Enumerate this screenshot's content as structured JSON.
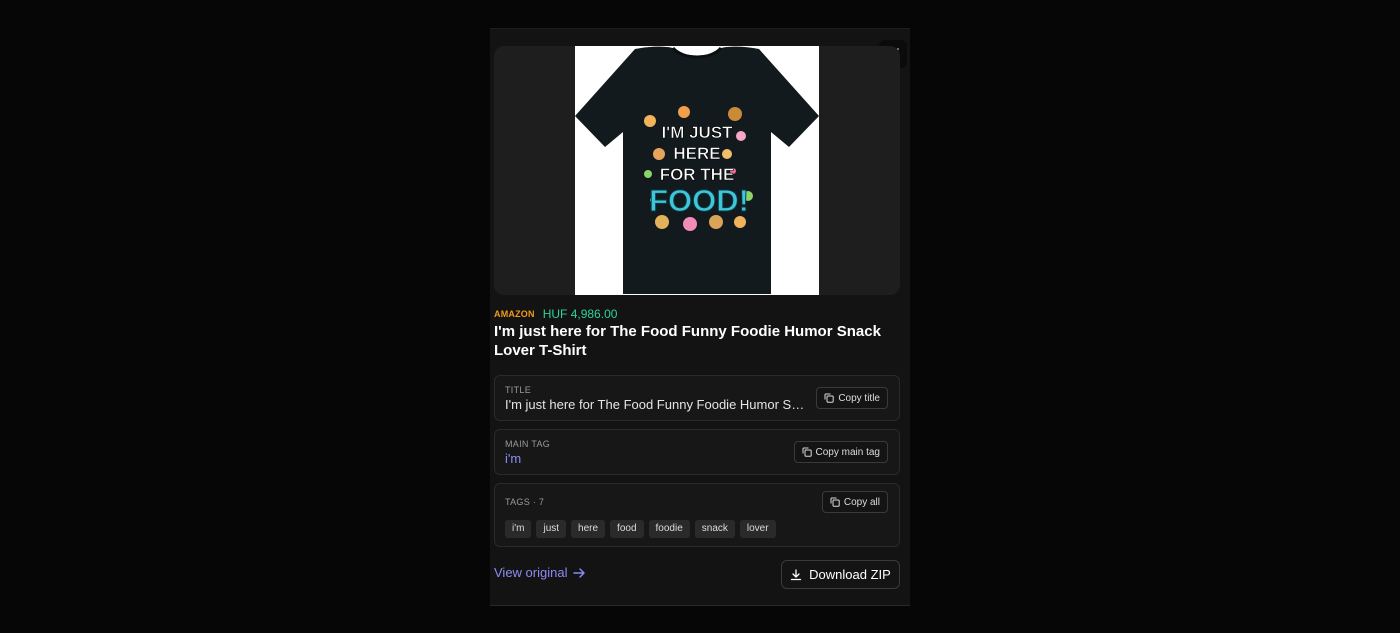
{
  "product": {
    "store": "AMAZON",
    "price": "HUF 4,986.00",
    "title": "I'm just here for The Food Funny Foodie Humor Snack Lover T-Shirt",
    "image_text": [
      "I'M JUST",
      "HERE",
      "FOR THE",
      "FOOD!"
    ]
  },
  "title_panel": {
    "label": "TITLE",
    "value": "I'm just here for The Food Funny Foodie Humor Snack Lover T-Shirt",
    "copy_label": "Copy title"
  },
  "main_tag_panel": {
    "label": "MAIN TAG",
    "value": "i'm",
    "copy_label": "Copy main tag"
  },
  "tags_panel": {
    "label": "TAGS · 7",
    "copy_label": "Copy all",
    "tags": [
      "i'm",
      "just",
      "here",
      "food",
      "foodie",
      "snack",
      "lover"
    ]
  },
  "actions": {
    "view_original": "View original",
    "download": "Download ZIP"
  },
  "colors": {
    "store": "#f29a1b",
    "price": "#2fd29b",
    "link": "#8c8cf5",
    "main_tag": "#8c8cf5"
  },
  "icons": {
    "close": "close-icon",
    "copy": "copy-icon",
    "arrow": "arrow-right-icon",
    "download": "download-icon"
  }
}
